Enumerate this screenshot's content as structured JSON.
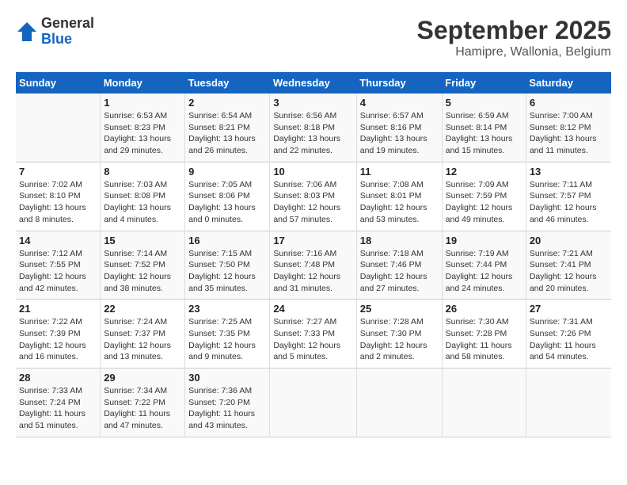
{
  "logo": {
    "general": "General",
    "blue": "Blue"
  },
  "title": "September 2025",
  "subtitle": "Hamipre, Wallonia, Belgium",
  "days_of_week": [
    "Sunday",
    "Monday",
    "Tuesday",
    "Wednesday",
    "Thursday",
    "Friday",
    "Saturday"
  ],
  "weeks": [
    [
      {
        "day": "",
        "info": ""
      },
      {
        "day": "1",
        "info": "Sunrise: 6:53 AM\nSunset: 8:23 PM\nDaylight: 13 hours\nand 29 minutes."
      },
      {
        "day": "2",
        "info": "Sunrise: 6:54 AM\nSunset: 8:21 PM\nDaylight: 13 hours\nand 26 minutes."
      },
      {
        "day": "3",
        "info": "Sunrise: 6:56 AM\nSunset: 8:18 PM\nDaylight: 13 hours\nand 22 minutes."
      },
      {
        "day": "4",
        "info": "Sunrise: 6:57 AM\nSunset: 8:16 PM\nDaylight: 13 hours\nand 19 minutes."
      },
      {
        "day": "5",
        "info": "Sunrise: 6:59 AM\nSunset: 8:14 PM\nDaylight: 13 hours\nand 15 minutes."
      },
      {
        "day": "6",
        "info": "Sunrise: 7:00 AM\nSunset: 8:12 PM\nDaylight: 13 hours\nand 11 minutes."
      }
    ],
    [
      {
        "day": "7",
        "info": "Sunrise: 7:02 AM\nSunset: 8:10 PM\nDaylight: 13 hours\nand 8 minutes."
      },
      {
        "day": "8",
        "info": "Sunrise: 7:03 AM\nSunset: 8:08 PM\nDaylight: 13 hours\nand 4 minutes."
      },
      {
        "day": "9",
        "info": "Sunrise: 7:05 AM\nSunset: 8:06 PM\nDaylight: 13 hours\nand 0 minutes."
      },
      {
        "day": "10",
        "info": "Sunrise: 7:06 AM\nSunset: 8:03 PM\nDaylight: 12 hours\nand 57 minutes."
      },
      {
        "day": "11",
        "info": "Sunrise: 7:08 AM\nSunset: 8:01 PM\nDaylight: 12 hours\nand 53 minutes."
      },
      {
        "day": "12",
        "info": "Sunrise: 7:09 AM\nSunset: 7:59 PM\nDaylight: 12 hours\nand 49 minutes."
      },
      {
        "day": "13",
        "info": "Sunrise: 7:11 AM\nSunset: 7:57 PM\nDaylight: 12 hours\nand 46 minutes."
      }
    ],
    [
      {
        "day": "14",
        "info": "Sunrise: 7:12 AM\nSunset: 7:55 PM\nDaylight: 12 hours\nand 42 minutes."
      },
      {
        "day": "15",
        "info": "Sunrise: 7:14 AM\nSunset: 7:52 PM\nDaylight: 12 hours\nand 38 minutes."
      },
      {
        "day": "16",
        "info": "Sunrise: 7:15 AM\nSunset: 7:50 PM\nDaylight: 12 hours\nand 35 minutes."
      },
      {
        "day": "17",
        "info": "Sunrise: 7:16 AM\nSunset: 7:48 PM\nDaylight: 12 hours\nand 31 minutes."
      },
      {
        "day": "18",
        "info": "Sunrise: 7:18 AM\nSunset: 7:46 PM\nDaylight: 12 hours\nand 27 minutes."
      },
      {
        "day": "19",
        "info": "Sunrise: 7:19 AM\nSunset: 7:44 PM\nDaylight: 12 hours\nand 24 minutes."
      },
      {
        "day": "20",
        "info": "Sunrise: 7:21 AM\nSunset: 7:41 PM\nDaylight: 12 hours\nand 20 minutes."
      }
    ],
    [
      {
        "day": "21",
        "info": "Sunrise: 7:22 AM\nSunset: 7:39 PM\nDaylight: 12 hours\nand 16 minutes."
      },
      {
        "day": "22",
        "info": "Sunrise: 7:24 AM\nSunset: 7:37 PM\nDaylight: 12 hours\nand 13 minutes."
      },
      {
        "day": "23",
        "info": "Sunrise: 7:25 AM\nSunset: 7:35 PM\nDaylight: 12 hours\nand 9 minutes."
      },
      {
        "day": "24",
        "info": "Sunrise: 7:27 AM\nSunset: 7:33 PM\nDaylight: 12 hours\nand 5 minutes."
      },
      {
        "day": "25",
        "info": "Sunrise: 7:28 AM\nSunset: 7:30 PM\nDaylight: 12 hours\nand 2 minutes."
      },
      {
        "day": "26",
        "info": "Sunrise: 7:30 AM\nSunset: 7:28 PM\nDaylight: 11 hours\nand 58 minutes."
      },
      {
        "day": "27",
        "info": "Sunrise: 7:31 AM\nSunset: 7:26 PM\nDaylight: 11 hours\nand 54 minutes."
      }
    ],
    [
      {
        "day": "28",
        "info": "Sunrise: 7:33 AM\nSunset: 7:24 PM\nDaylight: 11 hours\nand 51 minutes."
      },
      {
        "day": "29",
        "info": "Sunrise: 7:34 AM\nSunset: 7:22 PM\nDaylight: 11 hours\nand 47 minutes."
      },
      {
        "day": "30",
        "info": "Sunrise: 7:36 AM\nSunset: 7:20 PM\nDaylight: 11 hours\nand 43 minutes."
      },
      {
        "day": "",
        "info": ""
      },
      {
        "day": "",
        "info": ""
      },
      {
        "day": "",
        "info": ""
      },
      {
        "day": "",
        "info": ""
      }
    ]
  ]
}
